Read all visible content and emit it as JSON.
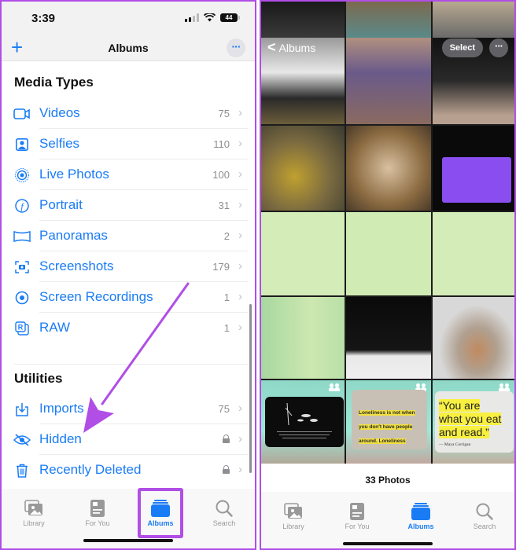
{
  "left": {
    "status": {
      "time": "3:39",
      "battery": "44"
    },
    "nav": {
      "title": "Albums",
      "add_icon": "plus-icon",
      "more_icon": "ellipsis-icon"
    },
    "media_types": {
      "title": "Media Types",
      "items": [
        {
          "label": "Videos",
          "count": "75",
          "icon": "video-camera-icon"
        },
        {
          "label": "Selfies",
          "count": "110",
          "icon": "selfie-portrait-icon"
        },
        {
          "label": "Live Photos",
          "count": "100",
          "icon": "live-photo-icon"
        },
        {
          "label": "Portrait",
          "count": "31",
          "icon": "portrait-f-icon"
        },
        {
          "label": "Panoramas",
          "count": "2",
          "icon": "panorama-icon"
        },
        {
          "label": "Screenshots",
          "count": "179",
          "icon": "screenshot-icon"
        },
        {
          "label": "Screen Recordings",
          "count": "1",
          "icon": "screen-record-icon"
        },
        {
          "label": "RAW",
          "count": "1",
          "icon": "raw-icon"
        }
      ]
    },
    "utilities": {
      "title": "Utilities",
      "items": [
        {
          "label": "Imports",
          "count": "75",
          "icon": "import-icon"
        },
        {
          "label": "Hidden",
          "locked": true,
          "icon": "eye-slash-icon"
        },
        {
          "label": "Recently Deleted",
          "locked": true,
          "icon": "trash-icon"
        }
      ]
    },
    "tabs": [
      {
        "label": "Library",
        "active": false
      },
      {
        "label": "For You",
        "active": false
      },
      {
        "label": "Albums",
        "active": true
      },
      {
        "label": "Search",
        "active": false
      }
    ]
  },
  "right": {
    "nav": {
      "back_label": "Albums",
      "select_label": "Select"
    },
    "quotes": {
      "q1": "Loneliness is not when you don't have people around. Loneliness occurs when you cannot find yourself inside you.",
      "q2_line1": "“You are",
      "q2_line2": "what you eat",
      "q2_line3": "and read.”",
      "q2_author": "— Maya Corrigan"
    },
    "photo_count": "33 Photos",
    "tabs": [
      {
        "label": "Library",
        "active": false
      },
      {
        "label": "For You",
        "active": false
      },
      {
        "label": "Albums",
        "active": true
      },
      {
        "label": "Search",
        "active": false
      }
    ]
  },
  "colors": {
    "accent": "#1a7cf5",
    "annotation": "#b04ee6",
    "secondary_text": "#8e8e93"
  }
}
